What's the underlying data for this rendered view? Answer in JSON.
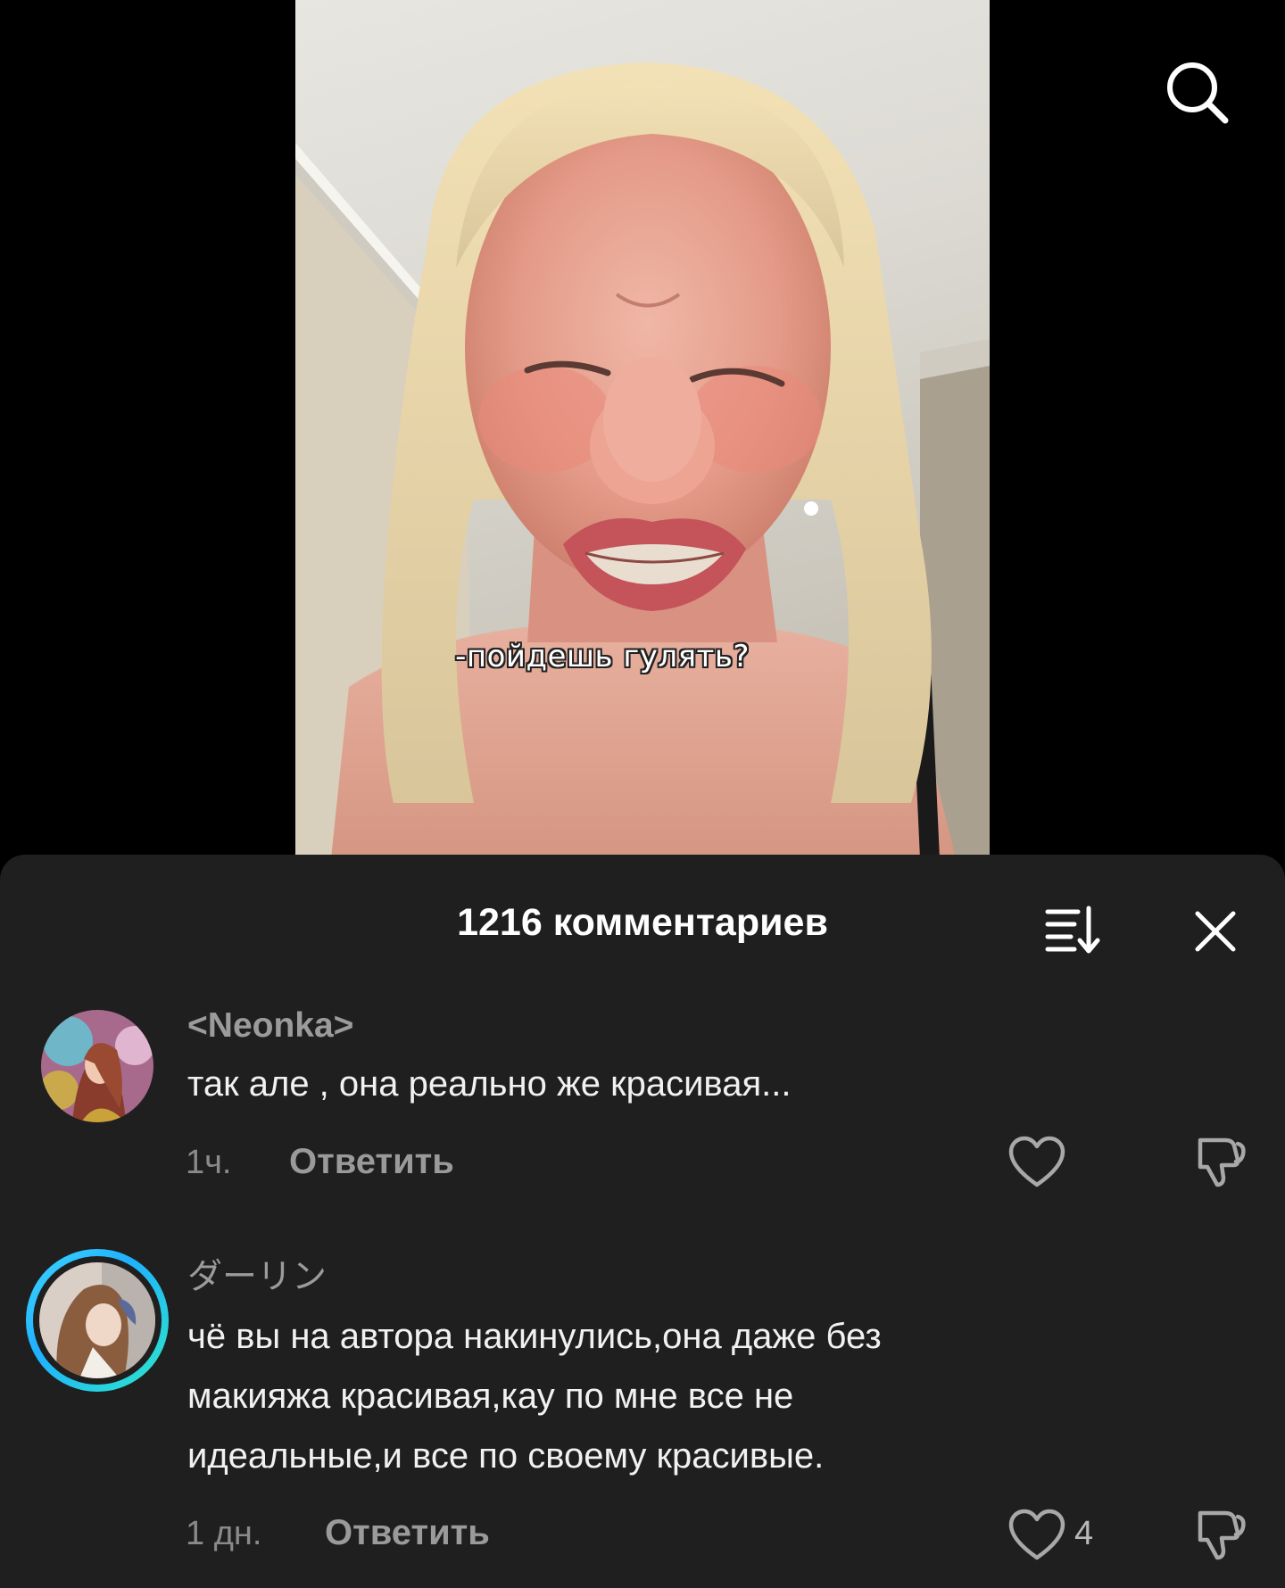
{
  "video": {
    "subtitle": "-пойдешь гулять?"
  },
  "comments_sheet": {
    "title": "1216 комментариев",
    "comments": [
      {
        "username": "<Neonka>",
        "text": "так але , она реально же красивая...",
        "time": "1ч.",
        "reply_label": "Ответить",
        "like_count": ""
      },
      {
        "username": "ダーリン",
        "text_lines": [
          "чё вы на автора накинулись,она даже без",
          "макияжа красивая,кау по мне все не",
          "идеальные,и все по своему красивые."
        ],
        "time": "1 дн.",
        "reply_label": "Ответить",
        "like_count": "4"
      }
    ]
  },
  "icons": {
    "search": "search-icon",
    "sort": "sort-icon",
    "close": "close-icon",
    "like": "heart-icon",
    "dislike": "thumbs-down-icon"
  },
  "colors": {
    "background": "#000000",
    "sheet": "#1f1f1f",
    "accent_ring": "#28c8ff"
  }
}
